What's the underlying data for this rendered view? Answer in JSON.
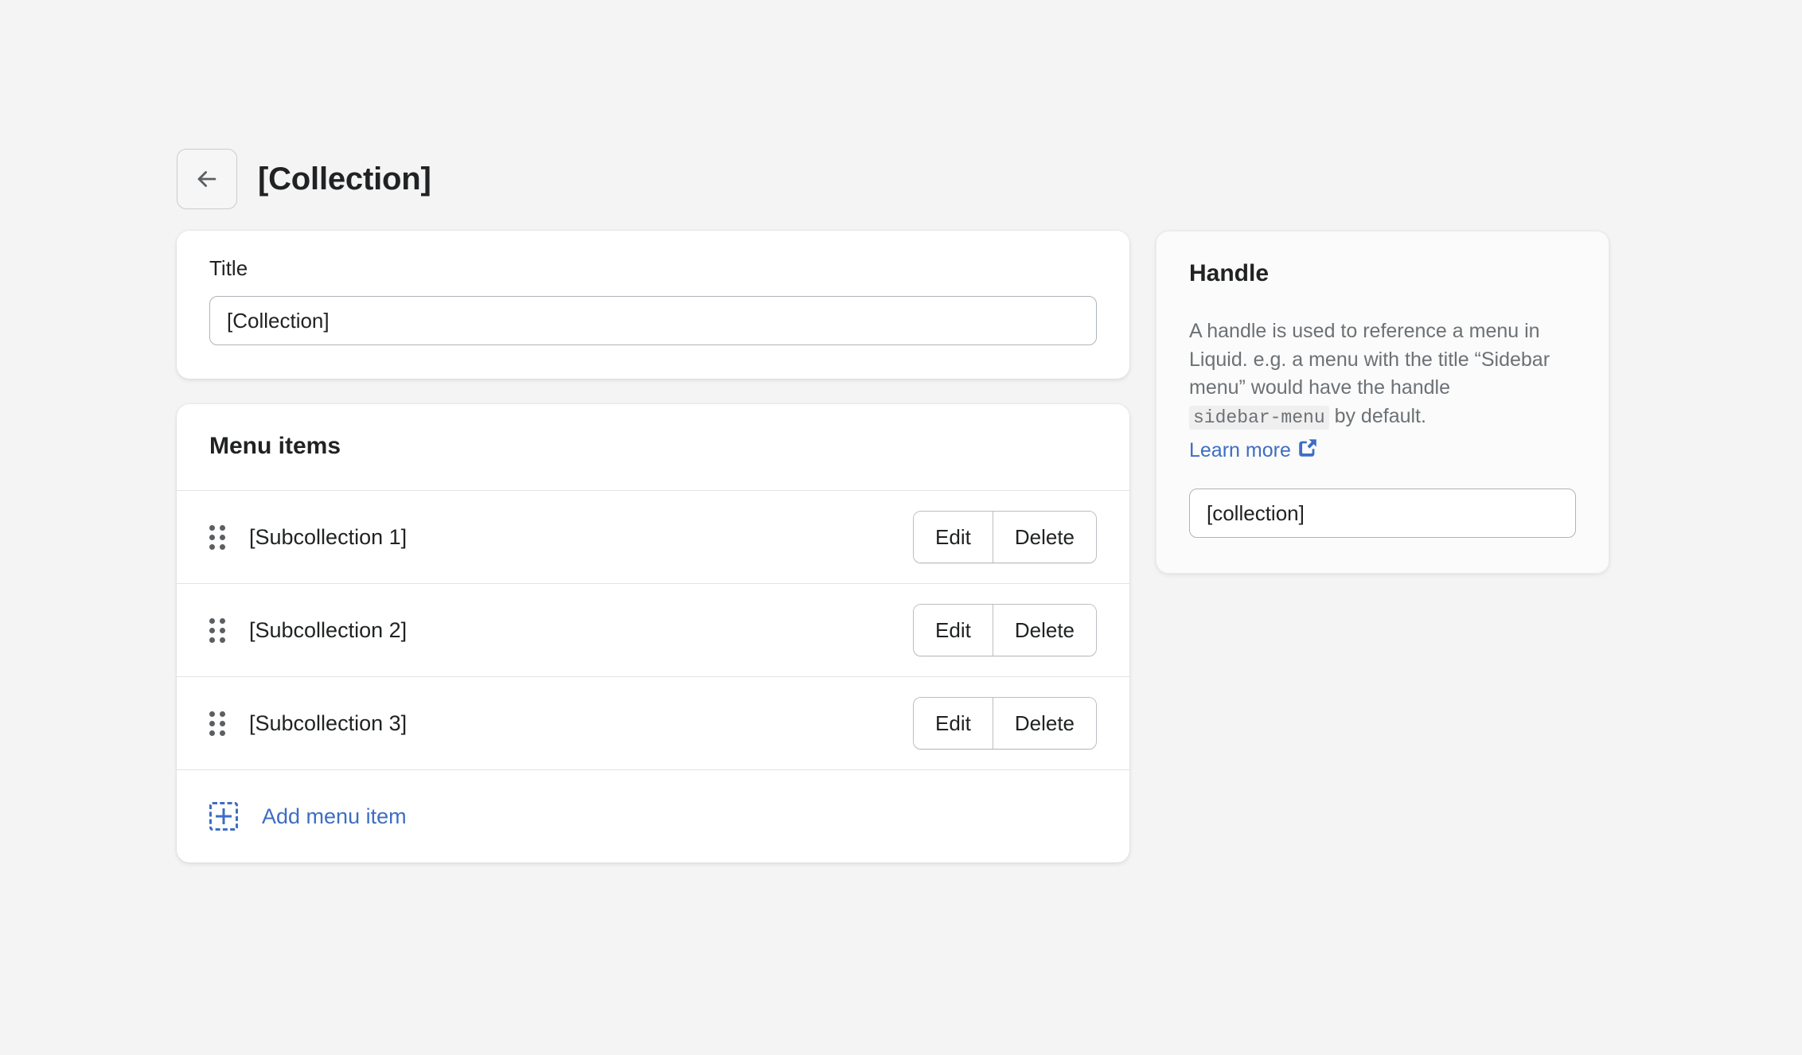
{
  "header": {
    "back_icon": "arrow-left-icon",
    "title": "[Collection]"
  },
  "title_card": {
    "label": "Title",
    "value": "[Collection]",
    "placeholder": ""
  },
  "menu_items_card": {
    "heading": "Menu items",
    "rows": [
      {
        "label": "[Subcollection 1]",
        "edit": "Edit",
        "delete": "Delete"
      },
      {
        "label": "[Subcollection 2]",
        "edit": "Edit",
        "delete": "Delete"
      },
      {
        "label": "[Subcollection 3]",
        "edit": "Edit",
        "delete": "Delete"
      }
    ],
    "add_label": "Add menu item",
    "add_icon": "plus-square-dashed-icon",
    "drag_icon": "drag-handle-icon"
  },
  "handle_card": {
    "heading": "Handle",
    "description_part1": "A handle is used to reference a menu in Liquid. e.g. a menu with the title “Sidebar menu” would have the handle ",
    "code": "sidebar-menu",
    "description_part2": " by default. ",
    "learn_more": "Learn more",
    "external_icon": "external-link-icon",
    "value": "[collection]",
    "placeholder": ""
  },
  "colors": {
    "page_background": "#f4f4f4",
    "accent_blue": "#3e6dc4",
    "text_primary": "#202223",
    "text_subdued": "#6d7175",
    "border": "#babec3",
    "divider": "#e1e3e5"
  }
}
